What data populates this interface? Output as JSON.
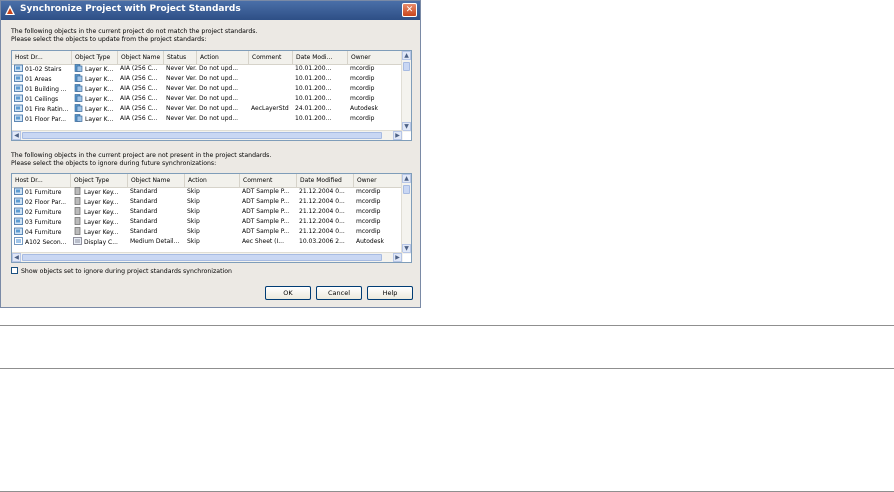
{
  "dialog": {
    "title": "Synchronize Project with Project Standards",
    "close_glyph": "✕"
  },
  "upper": {
    "instructions_line1": "The following objects in the current project do not match the project standards.",
    "instructions_line2": "Please select the objects to update from the project standards:",
    "columns": [
      "Host Dr...",
      "Object Type",
      "Object Name",
      "Status",
      "Action",
      "Comment",
      "Date Modi...",
      "Owner"
    ],
    "rows": [
      {
        "host": "01-02 Stairs",
        "type": "Layer K...",
        "name": "AIA (256 C...",
        "status": "Never Ver...",
        "action": "Do not upd...",
        "comment": "",
        "date": "10.01.200...",
        "owner": "mcordip"
      },
      {
        "host": "01 Areas",
        "type": "Layer K...",
        "name": "AIA (256 C...",
        "status": "Never Ver...",
        "action": "Do not upd...",
        "comment": "",
        "date": "10.01.200...",
        "owner": "mcordip"
      },
      {
        "host": "01 Building ...",
        "type": "Layer K...",
        "name": "AIA (256 C...",
        "status": "Never Ver...",
        "action": "Do not upd...",
        "comment": "",
        "date": "10.01.200...",
        "owner": "mcordip"
      },
      {
        "host": "01 Ceilings",
        "type": "Layer K...",
        "name": "AIA (256 C...",
        "status": "Never Ver...",
        "action": "Do not upd...",
        "comment": "",
        "date": "10.01.200...",
        "owner": "mcordip"
      },
      {
        "host": "01 Fire Ratin...",
        "type": "Layer K...",
        "name": "AIA (256 C...",
        "status": "Never Ver...",
        "action": "Do not upd...",
        "comment": "AecLayerStd",
        "date": "24.01.200...",
        "owner": "Autodesk"
      },
      {
        "host": "01 Floor Par...",
        "type": "Layer K...",
        "name": "AIA (256 C...",
        "status": "Never Ver...",
        "action": "Do not upd...",
        "comment": "",
        "date": "10.01.200...",
        "owner": "mcordip"
      }
    ]
  },
  "lower": {
    "instructions_line1": "The following objects in the current project are not present in the project standards.",
    "instructions_line2": "Please select the objects to ignore during future synchronizations:",
    "columns": [
      "Host Dr...",
      "Object Type",
      "Object Name",
      "Action",
      "Comment",
      "Date Modified",
      "Owner"
    ],
    "rows": [
      {
        "host": "01 Furniture",
        "type": "Layer Key...",
        "name": "Standard",
        "action": "Skip",
        "comment": "ADT Sample P...",
        "date": "21.12.2004 0...",
        "owner": "mcordip"
      },
      {
        "host": "02 Floor Par...",
        "type": "Layer Key...",
        "name": "Standard",
        "action": "Skip",
        "comment": "ADT Sample P...",
        "date": "21.12.2004 0...",
        "owner": "mcordip"
      },
      {
        "host": "02 Furniture",
        "type": "Layer Key...",
        "name": "Standard",
        "action": "Skip",
        "comment": "ADT Sample P...",
        "date": "21.12.2004 0...",
        "owner": "mcordip"
      },
      {
        "host": "03 Furniture",
        "type": "Layer Key...",
        "name": "Standard",
        "action": "Skip",
        "comment": "ADT Sample P...",
        "date": "21.12.2004 0...",
        "owner": "mcordip"
      },
      {
        "host": "04 Furniture",
        "type": "Layer Key...",
        "name": "Standard",
        "action": "Skip",
        "comment": "ADT Sample P...",
        "date": "21.12.2004 0...",
        "owner": "mcordip"
      },
      {
        "host": "A102 Secon...",
        "type": "Display C...",
        "name": "Medium Detail...",
        "action": "Skip",
        "comment": "Aec Sheet (I...",
        "date": "10.03.2006 2...",
        "owner": "Autodesk"
      }
    ]
  },
  "checkbox_label": "Show objects set to ignore during project standards synchronization",
  "buttons": {
    "ok": "OK",
    "cancel": "Cancel",
    "help": "Help"
  },
  "colors": {
    "title_bar": "#2e4f86",
    "selection_border": "#003c74",
    "grid_border": "#7f9db9"
  }
}
